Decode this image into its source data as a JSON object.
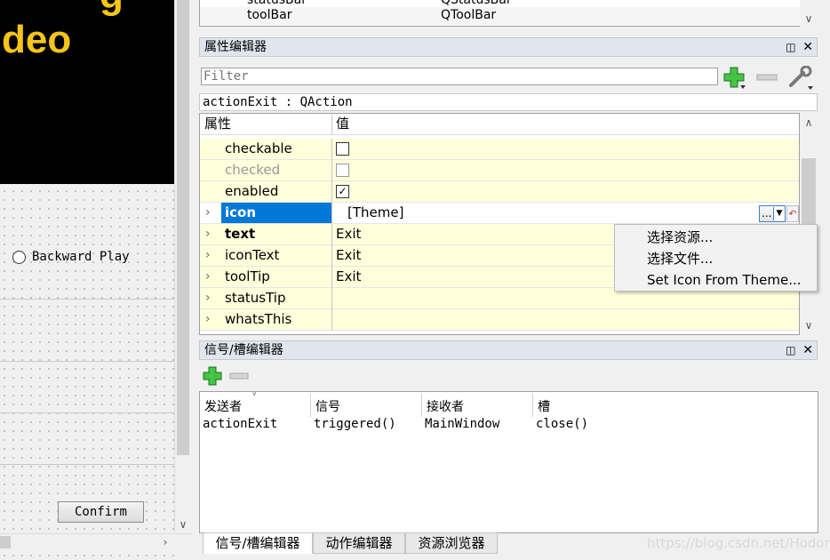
{
  "left_panel": {
    "video_title": "deo",
    "radio_label": "Backward Play",
    "confirm_label": "Confirm"
  },
  "object_list": {
    "rows": [
      {
        "name": "statusBar",
        "class": "QStatusBar"
      },
      {
        "name": "toolBar",
        "class": "QToolBar"
      }
    ]
  },
  "property_editor": {
    "title": "属性编辑器",
    "filter_placeholder": "Filter",
    "object_label": "actionExit : QAction",
    "header_property": "属性",
    "header_value": "值",
    "rows": [
      {
        "name": "checkable",
        "value": ""
      },
      {
        "name": "checked",
        "value": ""
      },
      {
        "name": "enabled",
        "value": "✓"
      },
      {
        "name": "icon",
        "value": "[Theme]"
      },
      {
        "name": "text",
        "value": "Exit"
      },
      {
        "name": "iconText",
        "value": "Exit"
      },
      {
        "name": "toolTip",
        "value": "Exit"
      },
      {
        "name": "statusTip",
        "value": ""
      },
      {
        "name": "whatsThis",
        "value": ""
      }
    ],
    "icon_button_label": "...",
    "context_menu": [
      "选择资源...",
      "选择文件...",
      "Set Icon From Theme..."
    ]
  },
  "signal_slot_editor": {
    "title": "信号/槽编辑器",
    "columns": [
      "发送者",
      "信号",
      "接收者",
      "槽"
    ],
    "rows": [
      [
        "actionExit",
        "triggered()",
        "MainWindow",
        "close()"
      ]
    ]
  },
  "bottom_tabs": [
    "信号/槽编辑器",
    "动作编辑器",
    "资源浏览器"
  ],
  "watermark": "https://blog.csdn.net/Hodors",
  "colors": {
    "selection": "#0078d7",
    "row_yellow": "#ffffdc",
    "header_bar": "#dfe6ee",
    "video_text": "#f5c518"
  }
}
